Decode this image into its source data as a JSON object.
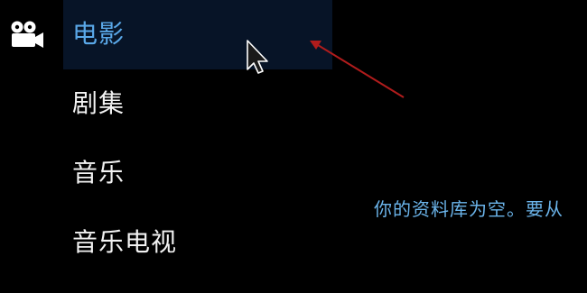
{
  "menu": {
    "items": [
      {
        "label": "电影",
        "icon": "movie-camera-icon",
        "selected": true
      },
      {
        "label": "剧集"
      },
      {
        "label": "音乐"
      },
      {
        "label": "音乐电视"
      }
    ]
  },
  "main": {
    "empty_message": "你的资料库为空。要从"
  },
  "colors": {
    "selected_text": "#5aa8e8",
    "selected_bg": "#071427",
    "default_text": "#f2f2f2",
    "message_text": "#6bb4ea",
    "arrow": "#b01c1c"
  }
}
